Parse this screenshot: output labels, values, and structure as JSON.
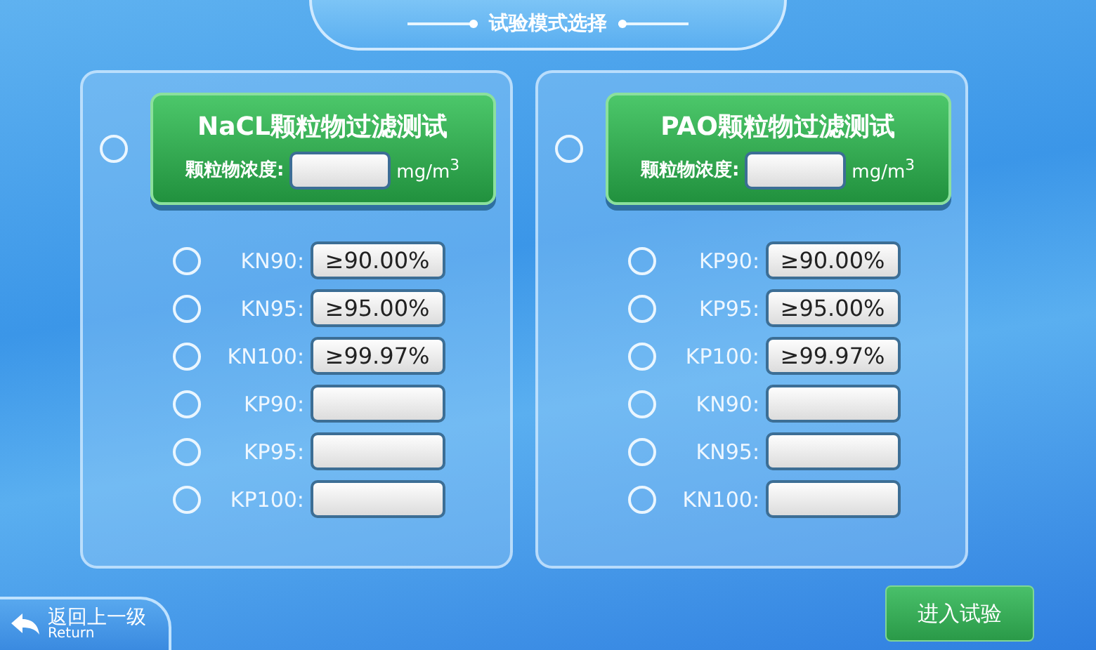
{
  "title": "试验模式选择",
  "panels": [
    {
      "selected": false,
      "title": "NaCL颗粒物过滤测试",
      "concentration_label": "颗粒物浓度:",
      "unit": "mg/m$^{3}$",
      "standards": [
        {
          "label": "KN90:",
          "value": "≥90.00%",
          "selected": false
        },
        {
          "label": "KN95:",
          "value": "≥95.00%",
          "selected": false
        },
        {
          "label": "KN100:",
          "value": "≥99.97%",
          "selected": false
        },
        {
          "label": "KP90:",
          "selected": false
        },
        {
          "label": "KP95:",
          "selected": false
        },
        {
          "label": "KP100:",
          "selected": false
        }
      ]
    },
    {
      "selected": false,
      "title": "PAO颗粒物过滤测试",
      "concentration_label": "颗粒物浓度:",
      "unit": "mg/m$^{3}$",
      "standards": [
        {
          "label": "KP90:",
          "value": "≥90.00%",
          "selected": false
        },
        {
          "label": "KP95:",
          "value": "≥95.00%",
          "selected": false
        },
        {
          "label": "KP100:",
          "value": "≥99.97%",
          "selected": false
        },
        {
          "label": "KN90:",
          "selected": false
        },
        {
          "label": "KN95:",
          "selected": false
        },
        {
          "label": "KN100:",
          "selected": false
        }
      ]
    }
  ],
  "return_button": {
    "label": "返回上一级",
    "sublabel": "Return"
  },
  "enter_button": {
    "label": "进入试验"
  }
}
